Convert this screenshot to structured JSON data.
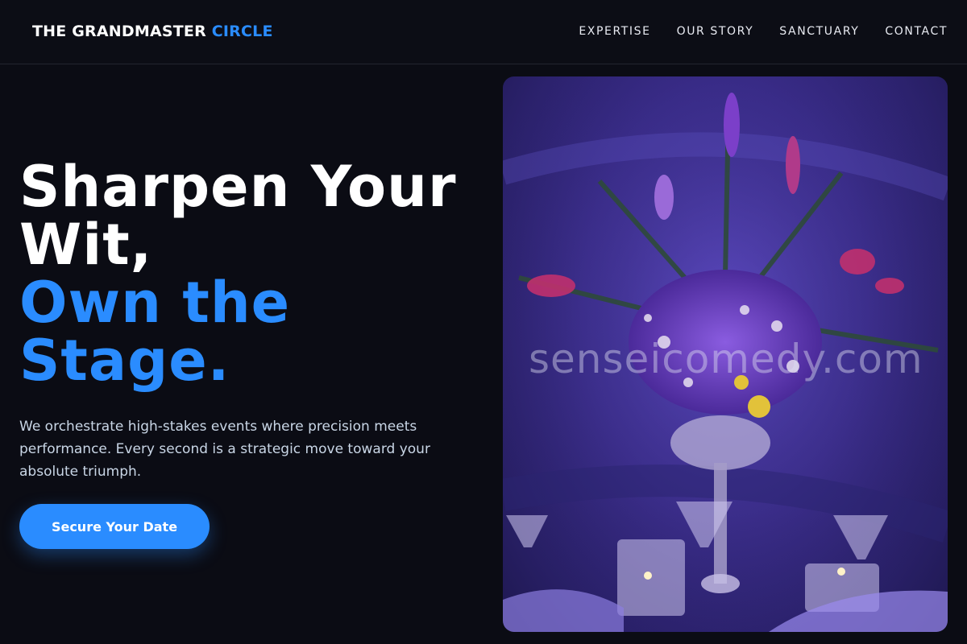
{
  "brand": {
    "name_main": "THE GRANDMASTER",
    "name_accent": "CIRCLE"
  },
  "nav": {
    "links": [
      "EXPERTISE",
      "OUR STORY",
      "SANCTUARY",
      "CONTACT"
    ]
  },
  "hero": {
    "headline_line1": "Sharpen Your",
    "headline_line2": "Wit,",
    "headline_line3": "Own the",
    "headline_line4": "Stage.",
    "description": "We orchestrate high-stakes events where precision meets performance. Every second is a strategic move toward your absolute triumph.",
    "cta_label": "Secure Your Date"
  },
  "image": {
    "subject": "floral-centerpiece-photo",
    "watermark": "senseicomedy.com"
  },
  "colors": {
    "accent": "#2a8cff",
    "background": "#0b0c14",
    "text": "#ffffff",
    "subtext": "#c9d6e6"
  }
}
